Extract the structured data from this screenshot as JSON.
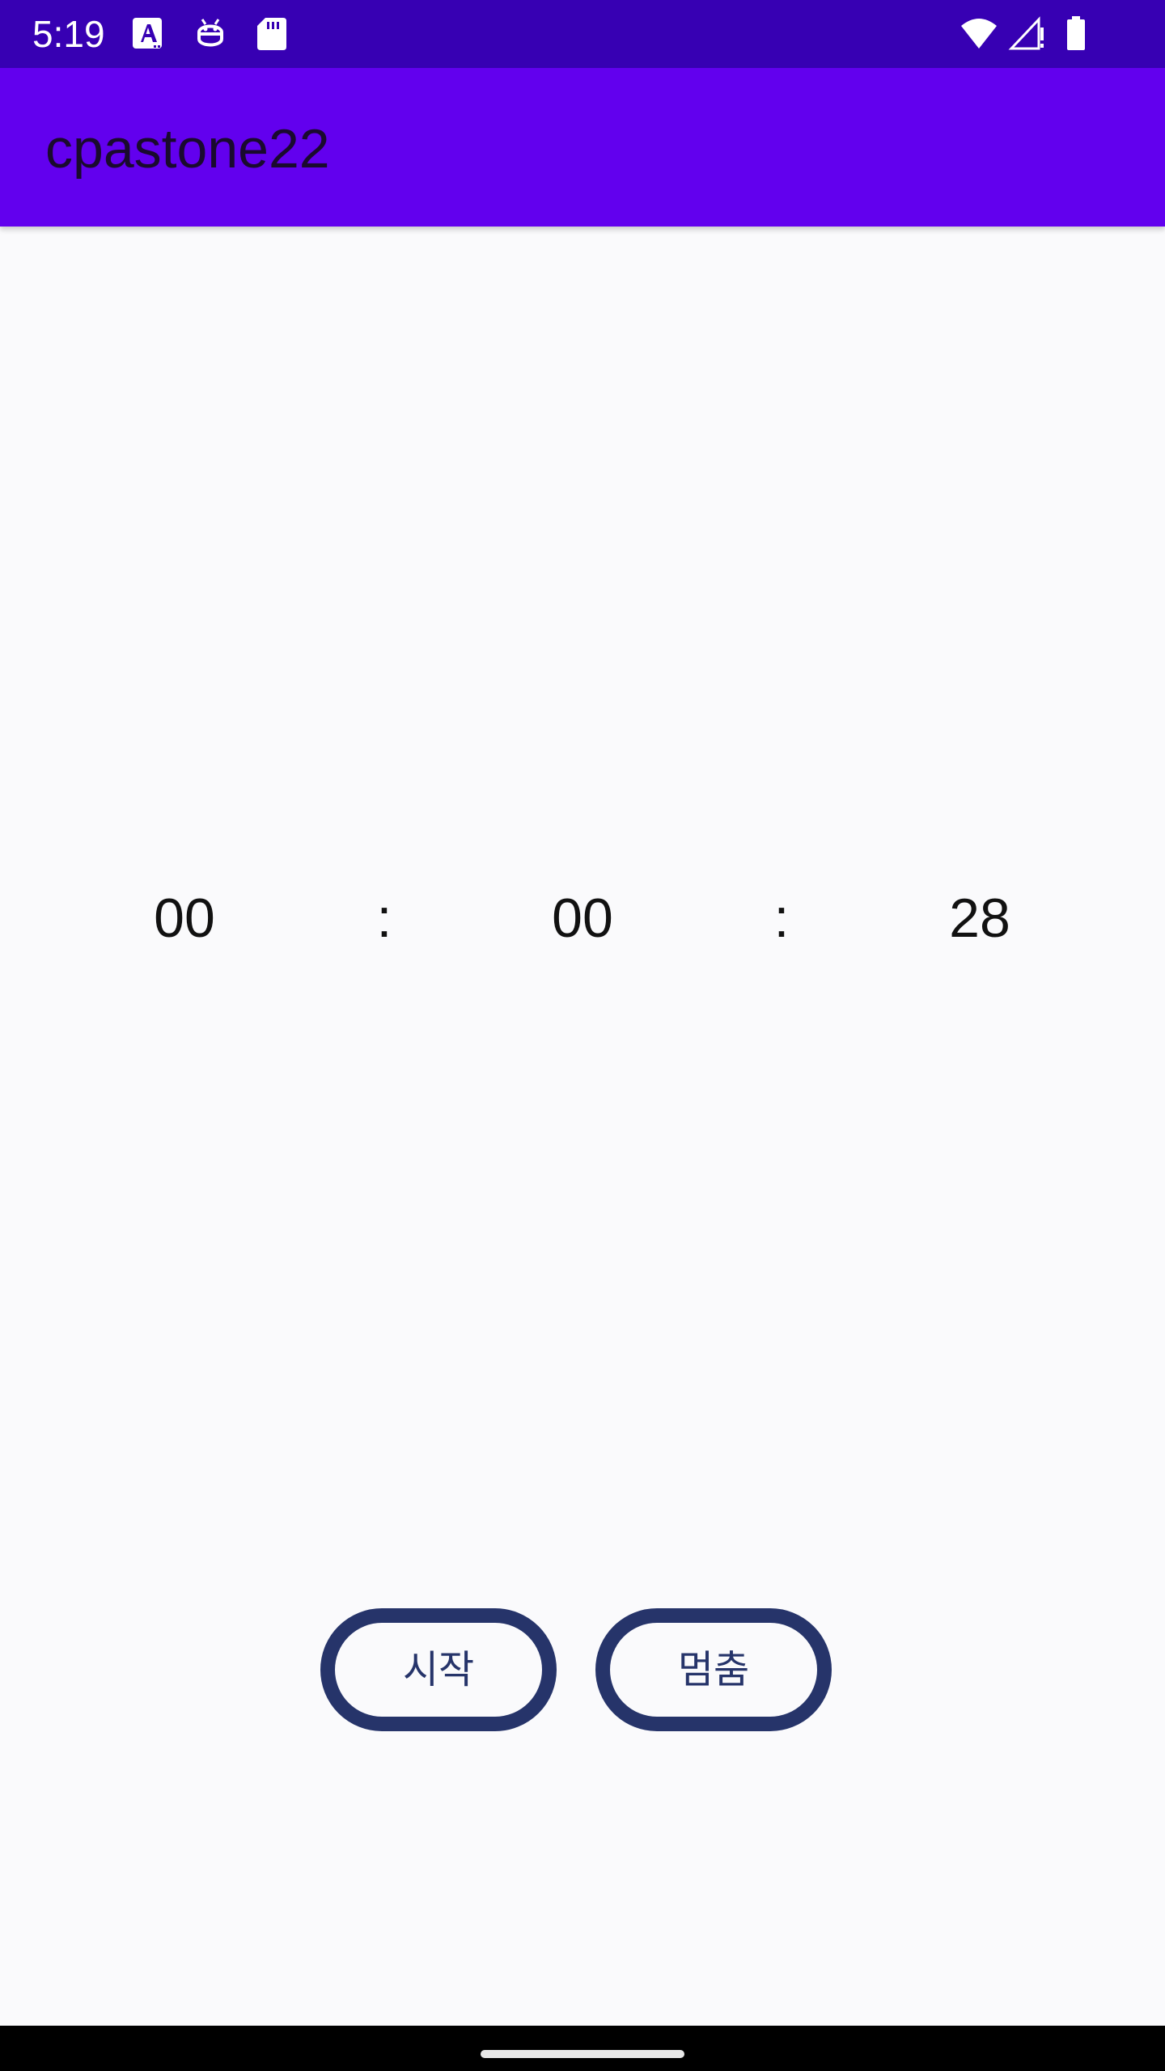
{
  "status_bar": {
    "time": "5:19",
    "background": "#3700B3",
    "icons_left": [
      "font-a-icon",
      "android-debug-icon",
      "sd-card-icon"
    ],
    "icons_right": [
      "wifi-icon",
      "cell-signal-alert-icon",
      "battery-icon"
    ]
  },
  "app_bar": {
    "title": "cpastone22",
    "background": "#6200EE"
  },
  "timer": {
    "hours": "00",
    "sep1": ":",
    "minutes": "00",
    "sep2": ":",
    "seconds": "28"
  },
  "buttons": {
    "start_label": "시작",
    "stop_label": "멈춤",
    "border_color": "#26346A"
  }
}
